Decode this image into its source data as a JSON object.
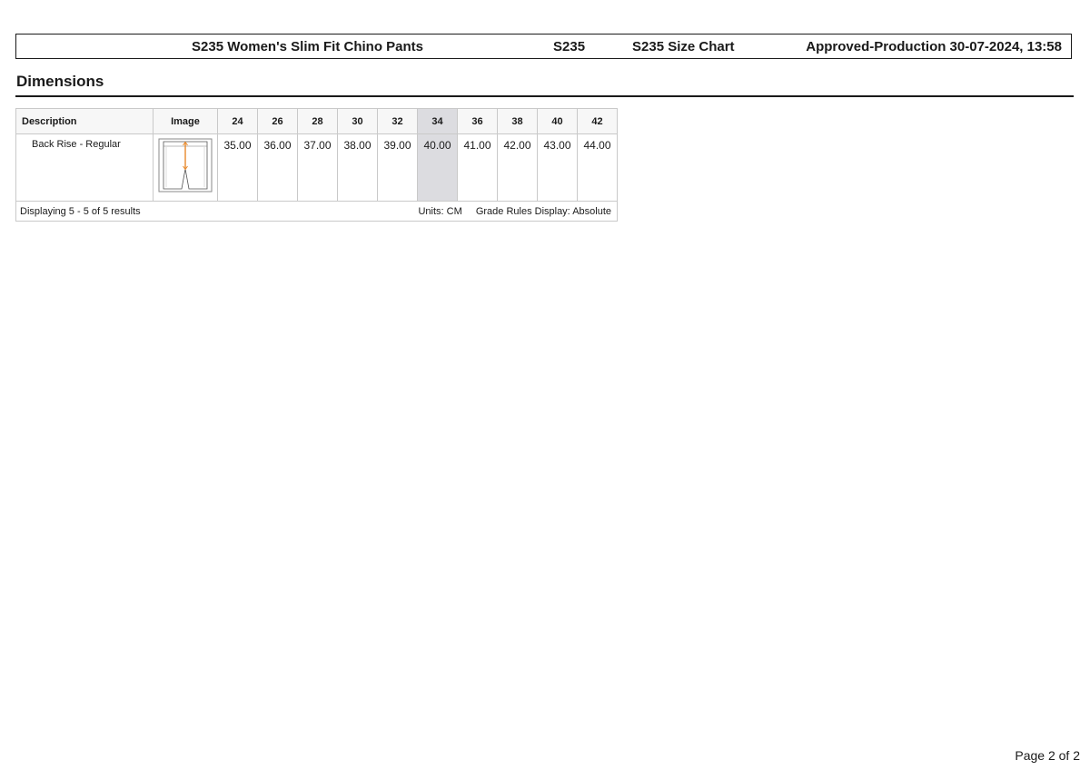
{
  "header": {
    "product_name": "S235 Women's Slim Fit Chino Pants",
    "style_code": "S235",
    "chart_name": "S235 Size Chart",
    "status": "Approved-Production 30-07-2024, 13:58"
  },
  "section": {
    "title": "Dimensions"
  },
  "table": {
    "headers": {
      "description": "Description",
      "image": "Image",
      "sizes": [
        "24",
        "26",
        "28",
        "30",
        "32",
        "34",
        "36",
        "38",
        "40",
        "42"
      ]
    },
    "highlighted_size": "34",
    "rows": [
      {
        "description": "Back Rise - Regular",
        "values": [
          "35.00",
          "36.00",
          "37.00",
          "38.00",
          "39.00",
          "40.00",
          "41.00",
          "42.00",
          "43.00",
          "44.00"
        ]
      }
    ],
    "footer": {
      "results": "Displaying 5 - 5 of 5 results",
      "units": "Units: CM",
      "grade_rules": "Grade Rules Display: Absolute"
    }
  },
  "colors": {
    "measure_line": "#e8892b",
    "highlight_column": "#dcdce0"
  },
  "page": {
    "number_text": "Page 2 of 2"
  }
}
